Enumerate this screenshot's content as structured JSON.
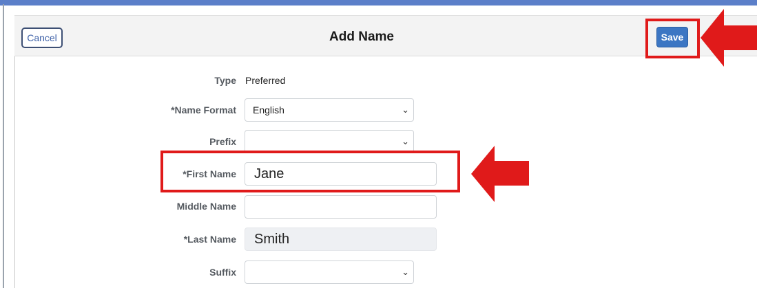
{
  "header": {
    "cancel_label": "Cancel",
    "title": "Add Name",
    "save_label": "Save"
  },
  "form": {
    "type": {
      "label": "Type",
      "value": "Preferred"
    },
    "name_format": {
      "label": "*Name Format",
      "value": "English"
    },
    "prefix": {
      "label": "Prefix",
      "value": ""
    },
    "first_name": {
      "label": "*First Name",
      "value": "Jane"
    },
    "middle_name": {
      "label": "Middle Name",
      "value": ""
    },
    "last_name": {
      "label": "*Last Name",
      "value": "Smith"
    },
    "suffix": {
      "label": "Suffix",
      "value": ""
    }
  },
  "icons": {
    "dropdown": "chevron-down-icon",
    "annotation": "red-arrow-icon"
  },
  "colors": {
    "accent": "#3c76c3",
    "highlight": "#e01a1a",
    "top_bar": "#5b7fc9"
  }
}
